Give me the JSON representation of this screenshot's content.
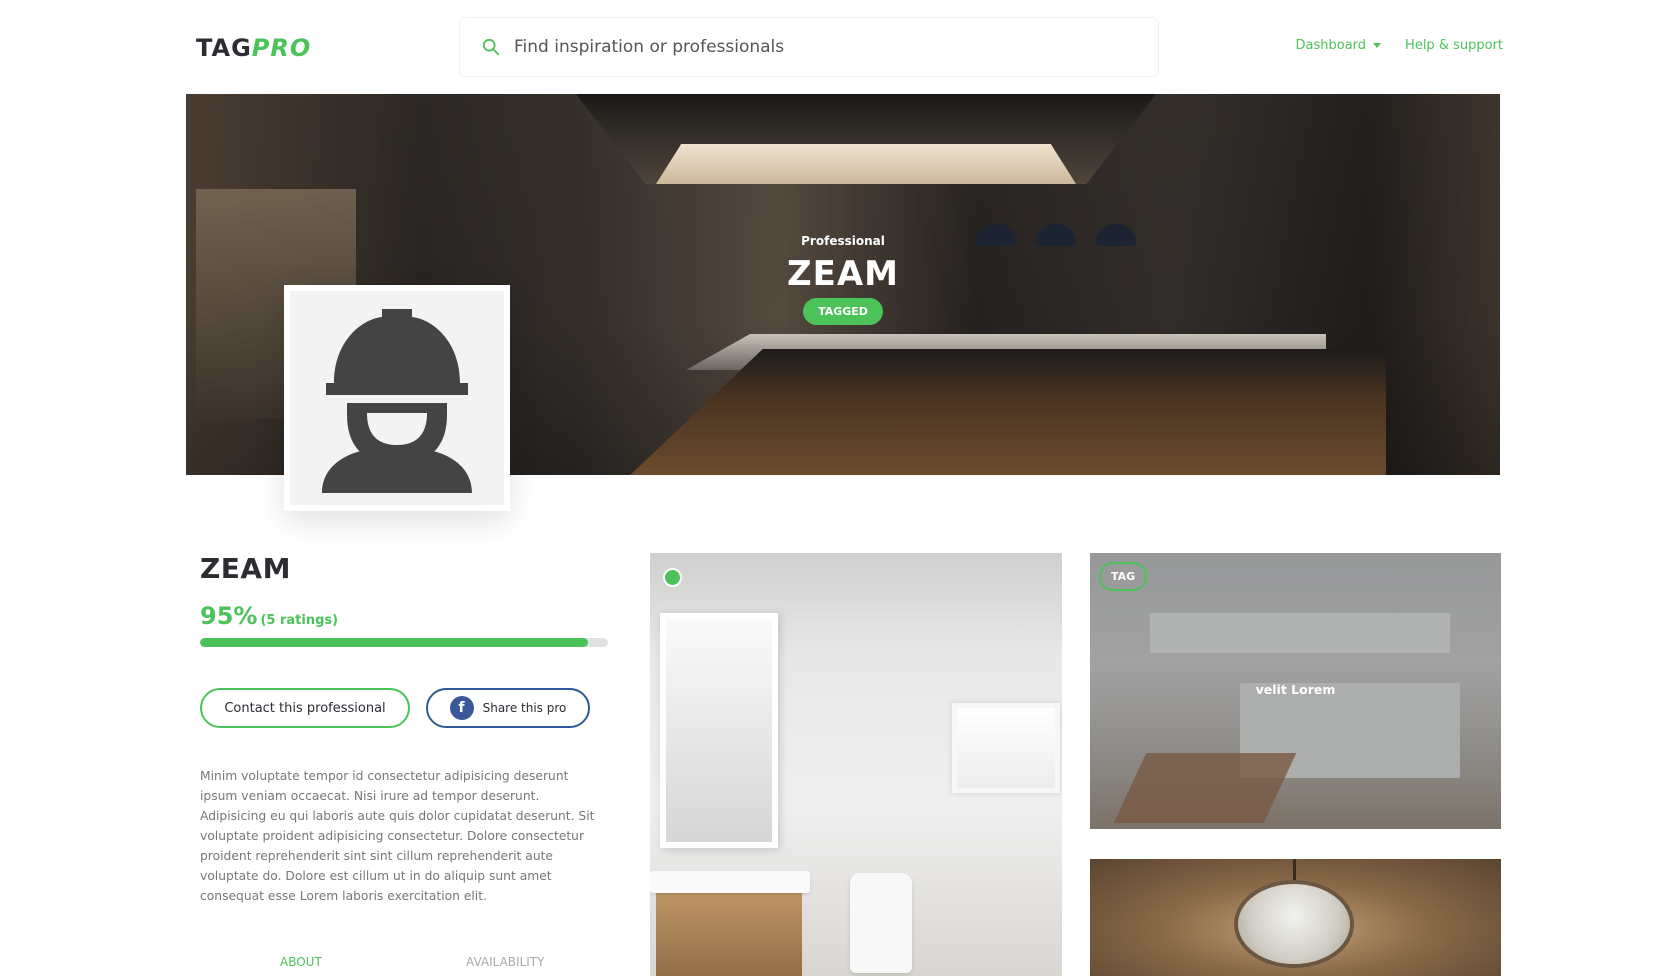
{
  "header": {
    "logo_part1": "TAG",
    "logo_part2": "PRO",
    "search_placeholder": "Find inspiration or professionals",
    "nav": {
      "dashboard": "Dashboard",
      "help": "Help & support"
    }
  },
  "hero": {
    "subtitle": "Professional",
    "title": "ZEAM",
    "badge": "TAGGED"
  },
  "profile": {
    "name": "ZEAM",
    "rating_percent": "95%",
    "rating_count": "(5 ratings)",
    "rating_fraction": 0.95,
    "contact_label": "Contact this professional",
    "share_label": "Share this pro",
    "description": "Minim voluptate tempor id consectetur adipisicing deserunt ipsum veniam occaecat. Nisi irure ad tempor deserunt. Adipisicing eu qui laboris aute quis dolor cupidatat deserunt. Sit voluptate proident adipisicing consectetur. Dolore consectetur proident reprehenderit sint sint cillum reprehenderit aute voluptate do. Dolore est cillum ut in do aliquip sunt amet consequat esse Lorem laboris exercitation elit."
  },
  "tabs": {
    "about": "ABOUT",
    "availability": "AVAILABILITY"
  },
  "gallery": {
    "tag_label": "TAG",
    "kitchen_caption": "velit Lorem"
  },
  "colors": {
    "accent": "#4cc25a",
    "facebook": "#3b5998",
    "dark_text": "#2b2d33"
  },
  "icons": {
    "search": "search-icon",
    "facebook": "facebook-icon",
    "worker": "construction-worker-icon"
  }
}
